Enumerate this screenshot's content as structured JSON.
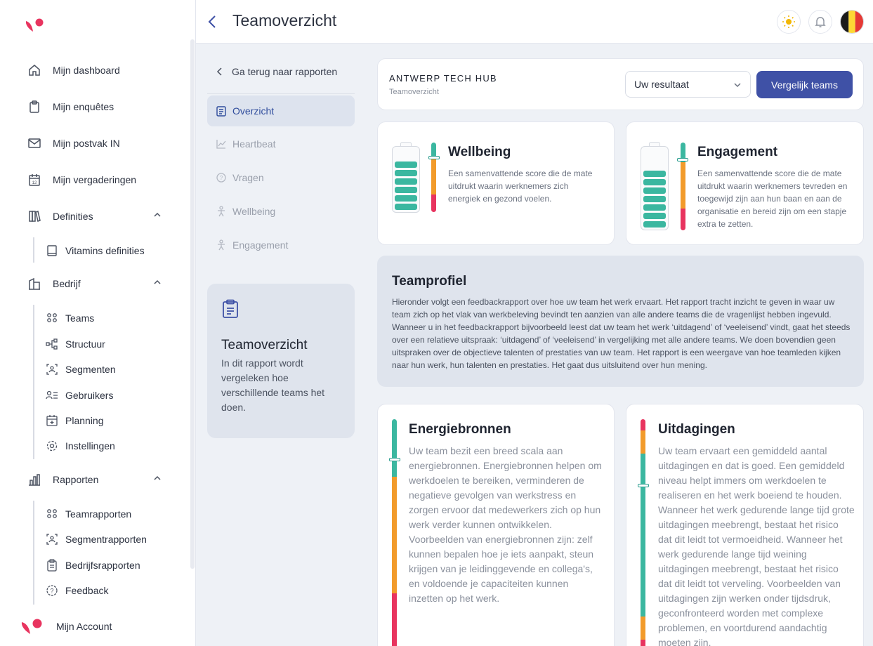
{
  "sidebar": {
    "items": [
      {
        "label": "Mijn dashboard",
        "icon": "home-icon"
      },
      {
        "label": "Mijn enquêtes",
        "icon": "clipboard-icon"
      },
      {
        "label": "Mijn postvak IN",
        "icon": "mail-icon"
      },
      {
        "label": "Mijn vergaderingen",
        "icon": "calendar-icon"
      },
      {
        "label": "Definities",
        "icon": "books-icon"
      },
      {
        "label": "Bedrijf",
        "icon": "building-icon"
      },
      {
        "label": "Rapporten",
        "icon": "bar-chart-icon"
      }
    ],
    "definities_sub": [
      {
        "label": "Vitamins definities",
        "icon": "book-icon"
      }
    ],
    "bedrijf_sub": [
      {
        "label": "Teams",
        "icon": "team-icon"
      },
      {
        "label": "Structuur",
        "icon": "structure-icon"
      },
      {
        "label": "Segmenten",
        "icon": "segment-icon"
      },
      {
        "label": "Gebruikers",
        "icon": "users-list-icon"
      },
      {
        "label": "Planning",
        "icon": "calendar-plus-icon"
      },
      {
        "label": "Instellingen",
        "icon": "gear-icon"
      }
    ],
    "rapporten_sub": [
      {
        "label": "Teamrapporten",
        "icon": "team-icon"
      },
      {
        "label": "Segmentrapporten",
        "icon": "segment-icon"
      },
      {
        "label": "Bedrijfsrapporten",
        "icon": "clipboard-icon"
      },
      {
        "label": "Feedback",
        "icon": "feedback-icon"
      }
    ],
    "account": "Mijn Account"
  },
  "header": {
    "title": "Teamoverzicht"
  },
  "subnav": {
    "back": "Ga terug naar rapporten",
    "items": [
      {
        "label": "Overzicht",
        "active": true
      },
      {
        "label": "Heartbeat",
        "active": false
      },
      {
        "label": "Vragen",
        "active": false
      },
      {
        "label": "Wellbeing",
        "active": false
      },
      {
        "label": "Engagement",
        "active": false
      }
    ],
    "card_title": "Teamoverzicht",
    "card_desc": "In dit rapport wordt vergeleken hoe verschillende teams het doen."
  },
  "org": {
    "name": "ANTWERP TECH HUB",
    "subtitle": "Teamoverzicht",
    "select_value": "Uw resultaat",
    "compare_button": "Vergelijk teams"
  },
  "metrics": {
    "wellbeing": {
      "title": "Wellbeing",
      "desc": "Een samenvattende score die de mate uitdrukt waarin werknemers zich energiek en gezond voelen.",
      "cells": 6
    },
    "engagement": {
      "title": "Engagement",
      "desc": "Een samenvattende score die de mate uitdrukt waarin werknemers tevreden en toegewijd zijn aan hun baan en aan de organisatie en bereid zijn om een stapje extra te zetten.",
      "cells": 7
    }
  },
  "profile": {
    "title": "Teamprofiel",
    "text": "Hieronder volgt een feedbackrapport over hoe uw team het werk ervaart. Het rapport tracht inzicht te geven in waar uw team zich op het vlak van werkbeleving bevindt ten aanzien van alle andere teams die de vragenlijst hebben ingevuld. Wanneer u in het feedbackrapport bijvoorbeeld leest dat uw team het werk ‘uitdagend’ of ‘veeleisend’ vindt, gaat het steeds over een relatieve uitspraak: ‘uitdagend’ of ‘veeleisend’ in vergelijking met alle andere teams. We doen bovendien geen uitspraken over de objectieve talenten of prestaties van uw team. Het rapport is een weergave van hoe teamleden kijken naar hun werk, hun talenten en prestaties. Het gaat dus uitsluitend over hun mening."
  },
  "energie": {
    "title": "Energiebronnen",
    "desc": "Uw team bezit een breed scala aan energiebronnen. Energiebronnen helpen om werkdoelen te bereiken, verminderen de negatieve gevolgen van werkstress en zorgen ervoor dat medewerkers zich op hun werk verder kunnen ontwikkelen. Voorbeelden van energiebronnen zijn: zelf kunnen bepalen hoe je iets aanpakt, steun krijgen van je leidinggevende en collega's, en voldoende je capaciteiten kunnen inzetten op het werk."
  },
  "uitdagingen": {
    "title": "Uitdagingen",
    "desc": "Uw team ervaart een gemiddeld aantal uitdagingen en dat is goed. Een gemiddeld niveau helpt immers om werkdoelen te realiseren en het werk boeiend te houden. Wanneer het werk gedurende lange tijd grote uitdagingen meebrengt, bestaat het risico dat dit leidt tot vermoeidheid. Wanneer het werk gedurende lange tijd weining uitdagingen meebrengt, bestaat het risico dat dit leidt tot verveling. Voorbeelden van uitdagingen zijn werken onder tijdsdruk, geconfronteerd worden met complexe problemen, en voortdurend aandachtig moeten zijn."
  },
  "colors": {
    "green": "#3bb7a0",
    "orange": "#f29b2b",
    "red": "#e8345f",
    "primary": "#3f51a6"
  }
}
